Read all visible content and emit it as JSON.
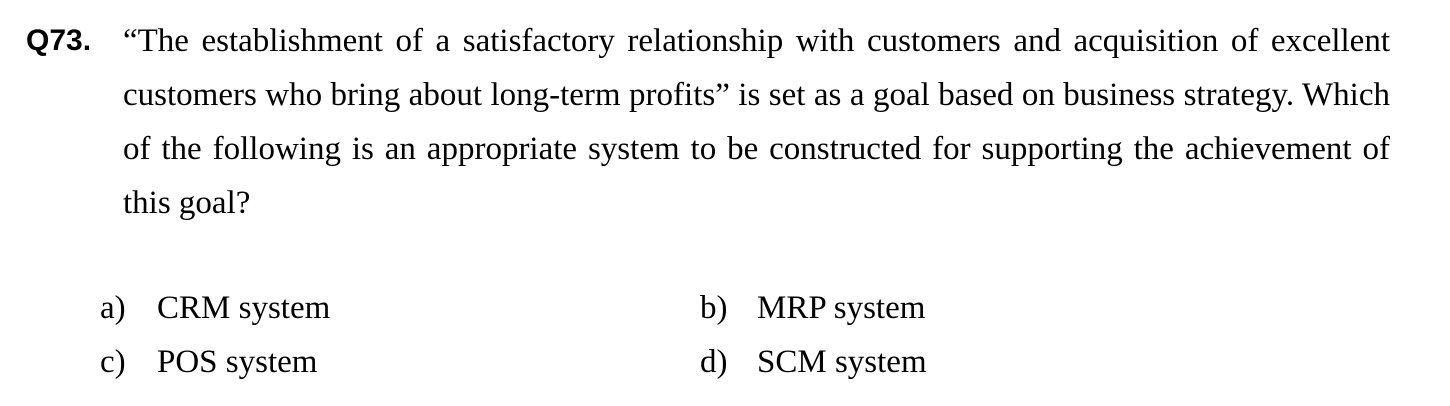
{
  "question": {
    "number": "Q73.",
    "text": "“The establishment of a satisfactory relationship with customers and acquisition of excellent customers who bring about long-term profits” is set as a goal based on business strategy.   Which of the following is an appropriate system to be constructed for supporting the achievement of this goal?"
  },
  "options": [
    {
      "letter": "a)",
      "text": "CRM system"
    },
    {
      "letter": "b)",
      "text": "MRP system"
    },
    {
      "letter": "c)",
      "text": "POS system"
    },
    {
      "letter": "d)",
      "text": "SCM system"
    }
  ]
}
